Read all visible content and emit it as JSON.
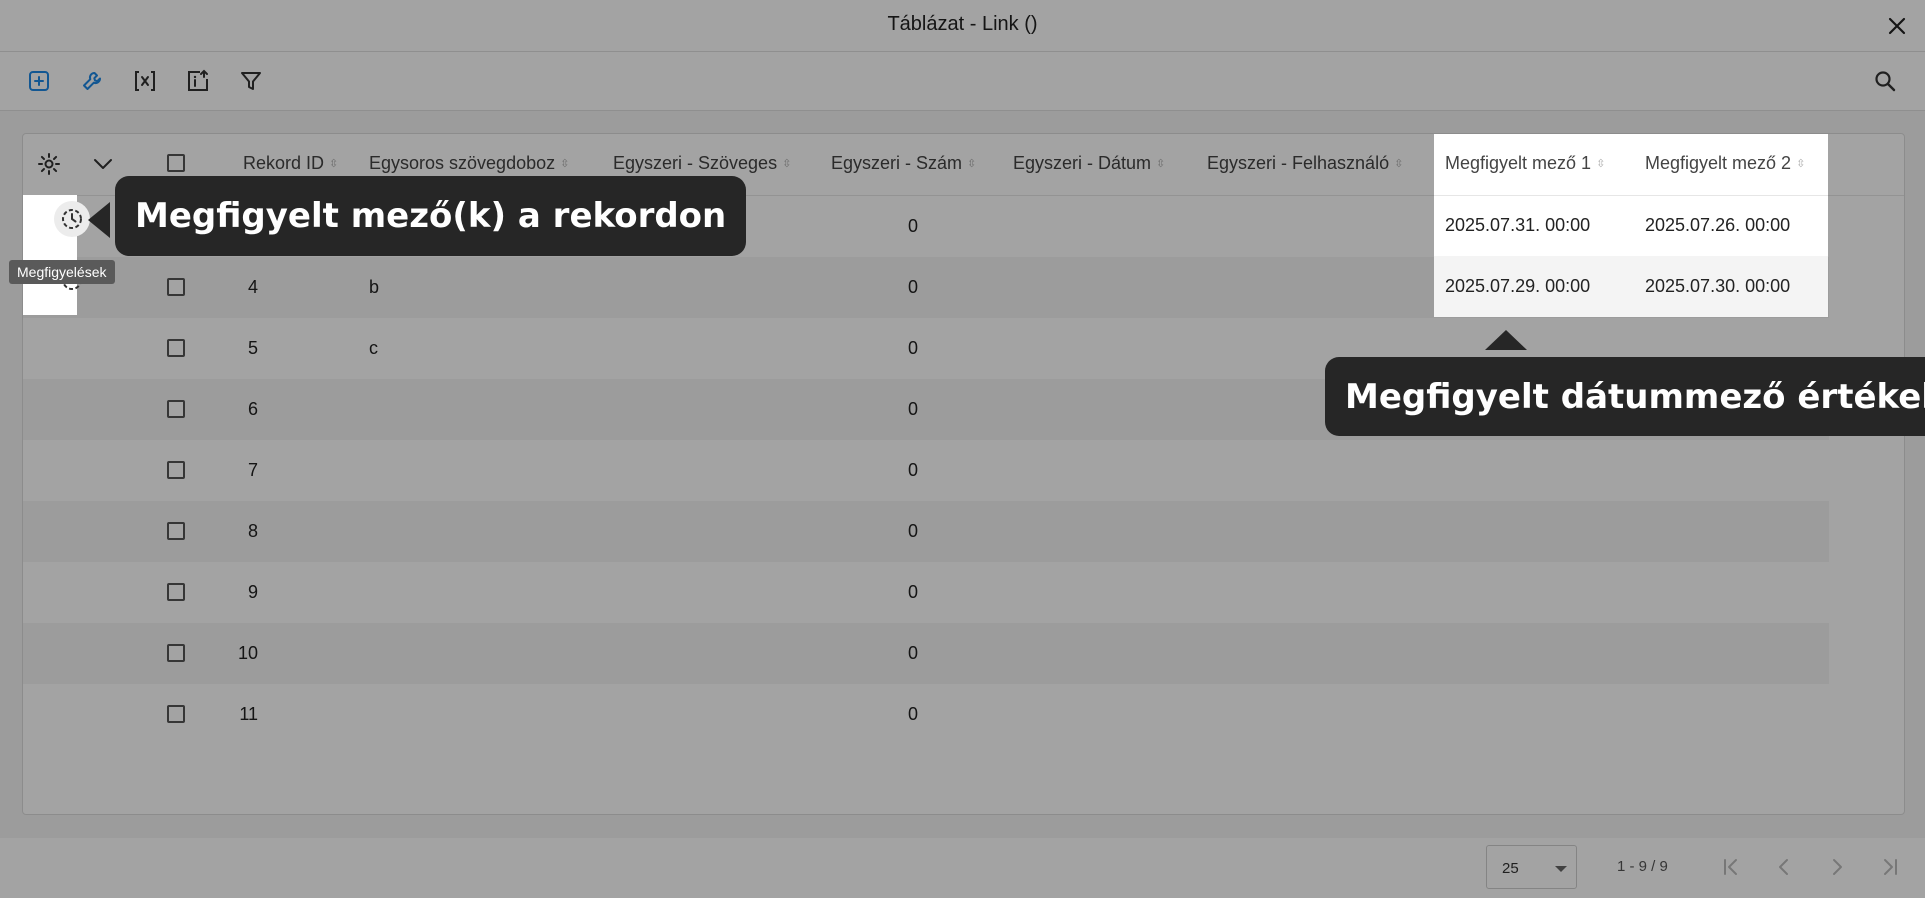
{
  "window": {
    "title": "Táblázat - Link ()"
  },
  "toolbar": {
    "tools": [
      "add-icon",
      "wrench-icon",
      "excel-export-icon",
      "import-icon",
      "filter-icon"
    ],
    "search_icon": "search-icon"
  },
  "colors": {
    "accent": "#1e88e5",
    "overlay": "rgba(0,0,0,0.36)",
    "callout_bg": "#262626"
  },
  "table": {
    "columns": [
      "Rekord ID",
      "Egysoros szövegdoboz",
      "Egyszeri - Szöveges",
      "Egyszeri - Szám",
      "Egyszeri - Dátum",
      "Egyszeri - Felhasználó",
      "Megfigyelt mező 1",
      "Megfigyelt mező 2"
    ],
    "rows": [
      {
        "id": "",
        "text": "",
        "single_text": "",
        "number": "0",
        "date": "",
        "user": "",
        "watched1": "2025.07.31. 00:00",
        "watched2": "2025.07.26. 00:00"
      },
      {
        "id": "4",
        "text": "b",
        "single_text": "",
        "number": "0",
        "date": "",
        "user": "",
        "watched1": "2025.07.29. 00:00",
        "watched2": "2025.07.30. 00:00"
      },
      {
        "id": "5",
        "text": "c",
        "single_text": "",
        "number": "0",
        "date": "",
        "user": "",
        "watched1": "",
        "watched2": ""
      },
      {
        "id": "6",
        "text": "",
        "single_text": "",
        "number": "0",
        "date": "",
        "user": "",
        "watched1": "",
        "watched2": ""
      },
      {
        "id": "7",
        "text": "",
        "single_text": "",
        "number": "0",
        "date": "",
        "user": "",
        "watched1": "",
        "watched2": ""
      },
      {
        "id": "8",
        "text": "",
        "single_text": "",
        "number": "0",
        "date": "",
        "user": "",
        "watched1": "",
        "watched2": ""
      },
      {
        "id": "9",
        "text": "",
        "single_text": "",
        "number": "0",
        "date": "",
        "user": "",
        "watched1": "",
        "watched2": ""
      },
      {
        "id": "10",
        "text": "",
        "single_text": "",
        "number": "0",
        "date": "",
        "user": "",
        "watched1": "",
        "watched2": ""
      },
      {
        "id": "11",
        "text": "",
        "single_text": "",
        "number": "0",
        "date": "",
        "user": "",
        "watched1": "",
        "watched2": ""
      }
    ]
  },
  "tooltip": "Megfigyelések",
  "callouts": {
    "row_watch": "Megfigyelt mező(k) a rekordon",
    "date_values": "Megfigyelt dátummező értékek"
  },
  "pagination": {
    "page_size": "25",
    "range": "1 - 9 / 9"
  }
}
